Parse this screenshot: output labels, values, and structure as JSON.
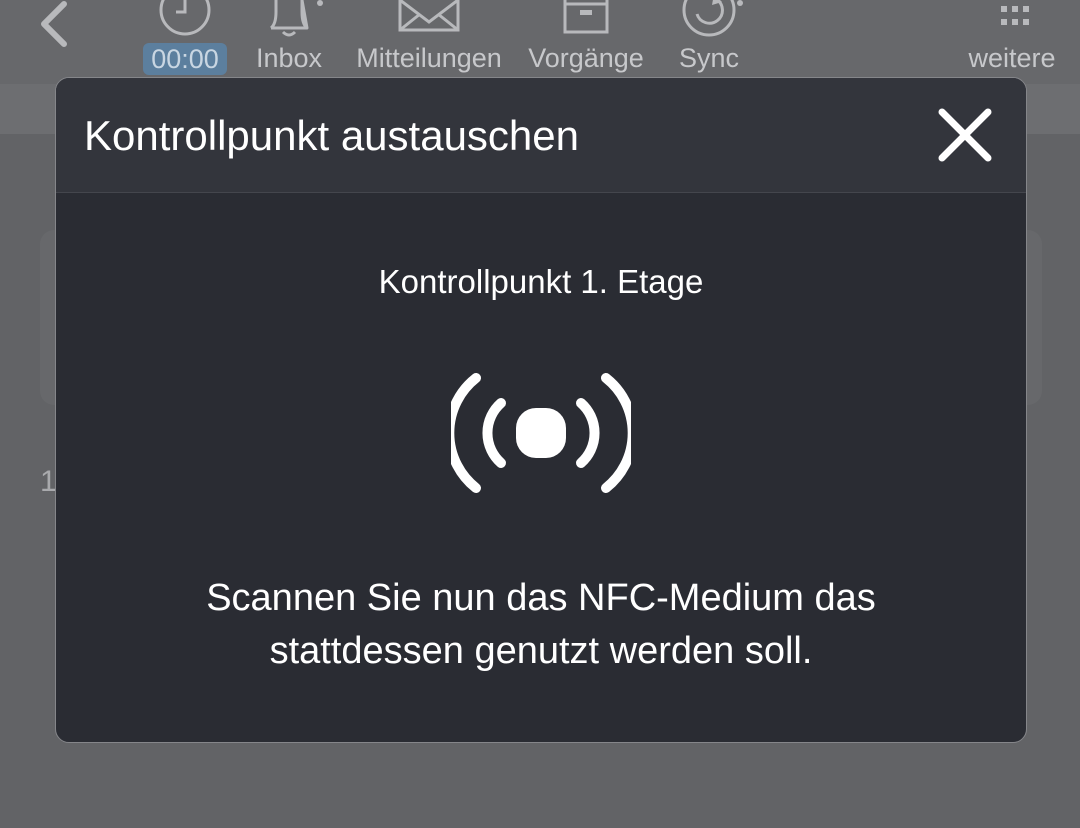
{
  "toolbar": {
    "back_icon": "chevron-left-icon",
    "items": [
      {
        "label": "00:00",
        "icon": "clock-icon"
      },
      {
        "label": "Inbox",
        "icon": "bell-icon"
      },
      {
        "label": "Mitteilungen",
        "icon": "envelope-icon"
      },
      {
        "label": "Vorgänge",
        "icon": "archive-box-icon"
      },
      {
        "label": "Sync",
        "icon": "sync-icon"
      },
      {
        "label": "weitere",
        "icon": "grid-dots-icon"
      }
    ]
  },
  "background": {
    "row_digit": "1"
  },
  "modal": {
    "title": "Kontrollpunkt austauschen",
    "close_icon": "close-icon",
    "checkpoint": "Kontrollpunkt 1. Etage",
    "nfc_icon": "nfc-signal-icon",
    "instruction": "Scannen Sie nun das NFC-Medium das stattdessen genutzt werden soll."
  },
  "colors": {
    "modal_background": "#2a2c33",
    "modal_header": "#33353c",
    "overlay_background": "#626366",
    "time_badge": "#5c7f9e"
  }
}
